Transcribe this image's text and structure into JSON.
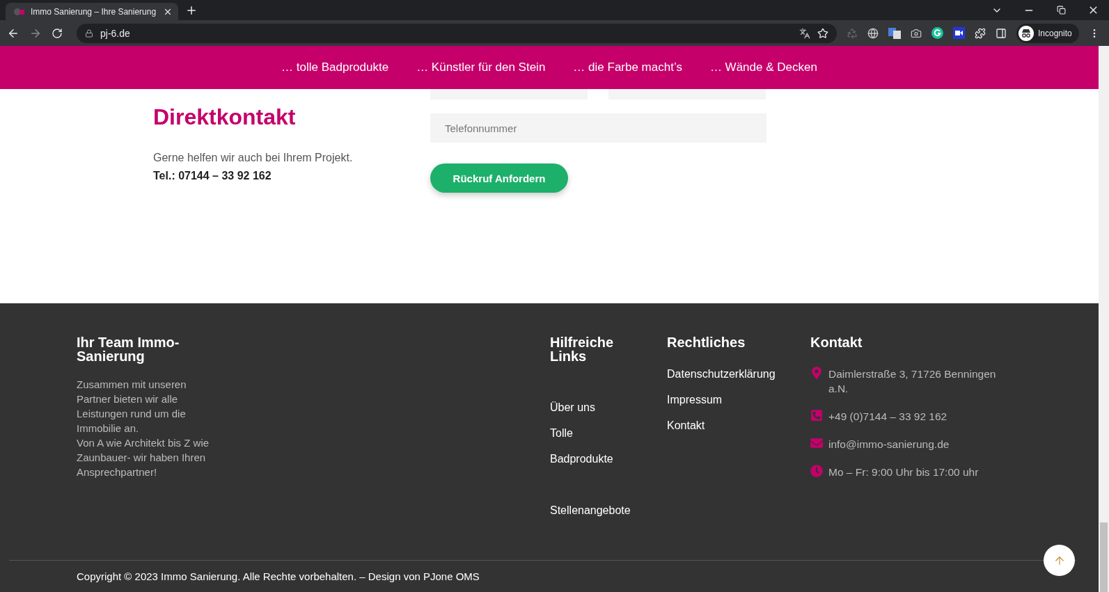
{
  "browser": {
    "tab_title": "Immo Sanierung – Ihre Sanierung",
    "url": "pj-6.de",
    "profile_label": "Incognito"
  },
  "nav": {
    "items": [
      "… tolle Badprodukte",
      "… Künstler für den Stein",
      "… die Farbe macht’s",
      "… Wände & Decken"
    ]
  },
  "contact": {
    "heading": "Direktkontakt",
    "text": "Gerne helfen wir auch bei Ihrem Projekt.",
    "phone": "Tel.: 07144 – 33 92 162",
    "phone_field": {
      "placeholder": "Telefonnummer"
    },
    "button": "Rückruf Anfordern"
  },
  "footer": {
    "about": {
      "title": "Ihr Team Immo-Sanierung",
      "paragraphs": [
        "Zusammen mit unseren Partner bieten wir alle Leistungen rund um die Immobilie an.",
        "Von A wie Architekt bis Z wie Zaunbauer- wir haben Ihren Ansprechpartner!"
      ]
    },
    "links": {
      "title": "Hilfreiche Links",
      "groups": [
        [
          "Über uns",
          "Tolle",
          "Badprodukte"
        ],
        [
          "Stellenangebote"
        ]
      ]
    },
    "legal": {
      "title": "Rechtliches",
      "items": [
        "Datenschutzerklärung",
        "Impressum",
        "Kontakt"
      ]
    },
    "contact": {
      "title": "Kontakt",
      "items": [
        {
          "kind": "address",
          "text": "Daimlerstraße 3, 71726 Benningen a.N."
        },
        {
          "kind": "phone",
          "text": "+49 (0)7144 – 33 92 162"
        },
        {
          "kind": "email",
          "text": "info@immo-sanierung.de"
        },
        {
          "kind": "hours",
          "text": "Mo – Fr: 9:00 Uhr bis 17:00 uhr"
        }
      ]
    },
    "copyright": "Copyright © 2023 Immo Sanierung. Alle Rechte vorbehalten. – Design von PJone OMS"
  }
}
